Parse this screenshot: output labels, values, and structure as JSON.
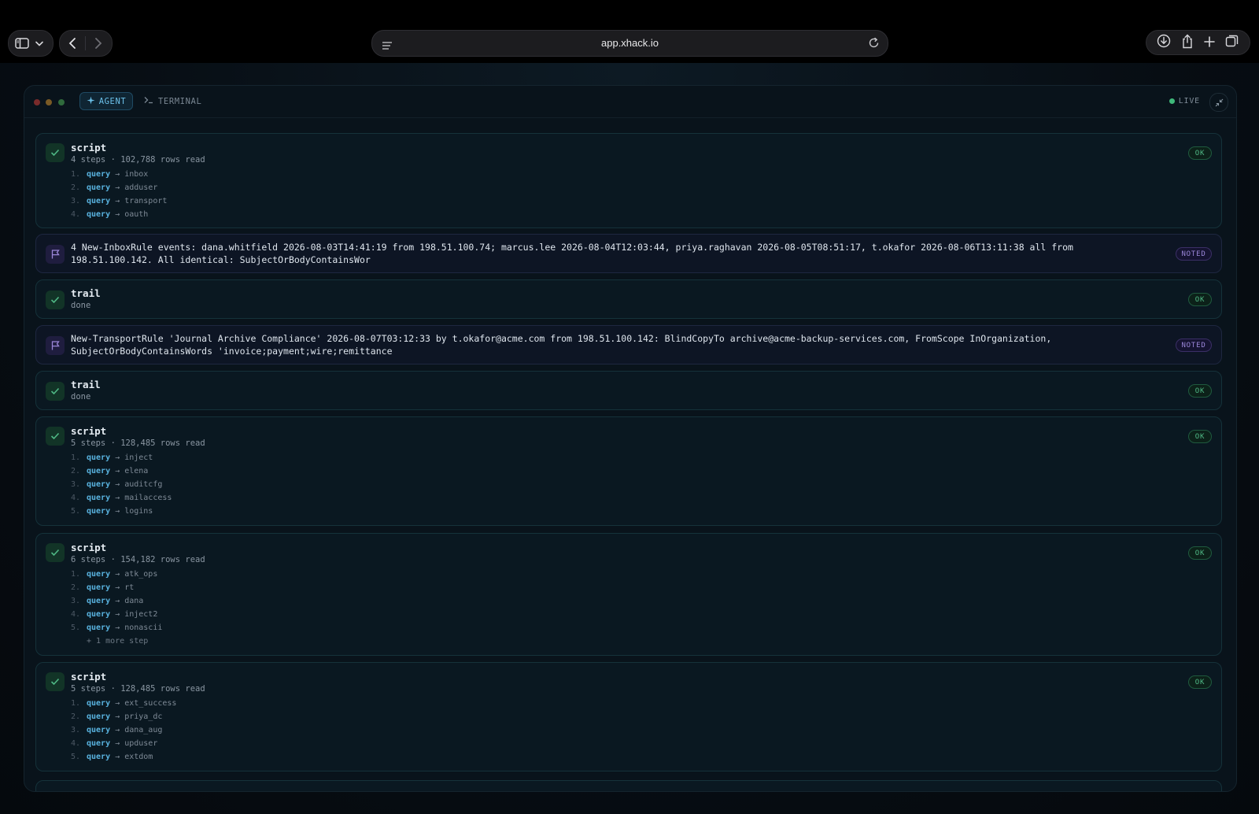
{
  "browser": {
    "url": "app.xhack.io"
  },
  "panel": {
    "tabs": [
      {
        "label": "AGENT",
        "icon": "sparkle-icon",
        "active": true
      },
      {
        "label": "TERMINAL",
        "icon": "terminal-prompt-icon",
        "active": false
      }
    ],
    "live_label": "LIVE",
    "accent": "#6cc1ea",
    "ok_color": "#4fb885",
    "noted_color": "#9a86d8"
  },
  "cards": [
    {
      "kind": "script",
      "title": "script",
      "subtitle": "4 steps · 102,788 rows read",
      "badge": "OK",
      "steps": [
        {
          "num": "1.",
          "kw": "query",
          "target": "inbox"
        },
        {
          "num": "2.",
          "kw": "query",
          "target": "adduser"
        },
        {
          "num": "3.",
          "kw": "query",
          "target": "transport"
        },
        {
          "num": "4.",
          "kw": "query",
          "target": "oauth"
        }
      ]
    },
    {
      "kind": "note",
      "text": "4 New-InboxRule events: dana.whitfield 2026-08-03T14:41:19 from 198.51.100.74; marcus.lee 2026-08-04T12:03:44, priya.raghavan 2026-08-05T08:51:17, t.okafor 2026-08-06T13:11:38 all from 198.51.100.142. All identical: SubjectOrBodyContainsWor",
      "badge": "NOTED"
    },
    {
      "kind": "trail",
      "title": "trail",
      "subtitle": "done",
      "badge": "OK"
    },
    {
      "kind": "note",
      "text": "New-TransportRule 'Journal Archive Compliance' 2026-08-07T03:12:33 by t.okafor@acme.com from 198.51.100.142: BlindCopyTo archive@acme-backup-services.com, FromScope InOrganization, SubjectOrBodyContainsWords 'invoice;payment;wire;remittance",
      "badge": "NOTED"
    },
    {
      "kind": "trail",
      "title": "trail",
      "subtitle": "done",
      "badge": "OK"
    },
    {
      "kind": "script",
      "title": "script",
      "subtitle": "5 steps · 128,485 rows read",
      "badge": "OK",
      "steps": [
        {
          "num": "1.",
          "kw": "query",
          "target": "inject"
        },
        {
          "num": "2.",
          "kw": "query",
          "target": "elena"
        },
        {
          "num": "3.",
          "kw": "query",
          "target": "auditcfg"
        },
        {
          "num": "4.",
          "kw": "query",
          "target": "mailaccess"
        },
        {
          "num": "5.",
          "kw": "query",
          "target": "logins"
        }
      ]
    },
    {
      "kind": "script",
      "title": "script",
      "subtitle": "6 steps · 154,182 rows read",
      "badge": "OK",
      "steps": [
        {
          "num": "1.",
          "kw": "query",
          "target": "atk_ops"
        },
        {
          "num": "2.",
          "kw": "query",
          "target": "rt"
        },
        {
          "num": "3.",
          "kw": "query",
          "target": "dana"
        },
        {
          "num": "4.",
          "kw": "query",
          "target": "inject2"
        },
        {
          "num": "5.",
          "kw": "query",
          "target": "nonascii"
        }
      ],
      "more": "+ 1 more step"
    },
    {
      "kind": "script",
      "title": "script",
      "subtitle": "5 steps · 128,485 rows read",
      "badge": "OK",
      "steps": [
        {
          "num": "1.",
          "kw": "query",
          "target": "ext_success"
        },
        {
          "num": "2.",
          "kw": "query",
          "target": "priya_dc"
        },
        {
          "num": "3.",
          "kw": "query",
          "target": "dana_aug"
        },
        {
          "num": "4.",
          "kw": "query",
          "target": "upduser"
        },
        {
          "num": "5.",
          "kw": "query",
          "target": "extdom"
        }
      ]
    }
  ]
}
